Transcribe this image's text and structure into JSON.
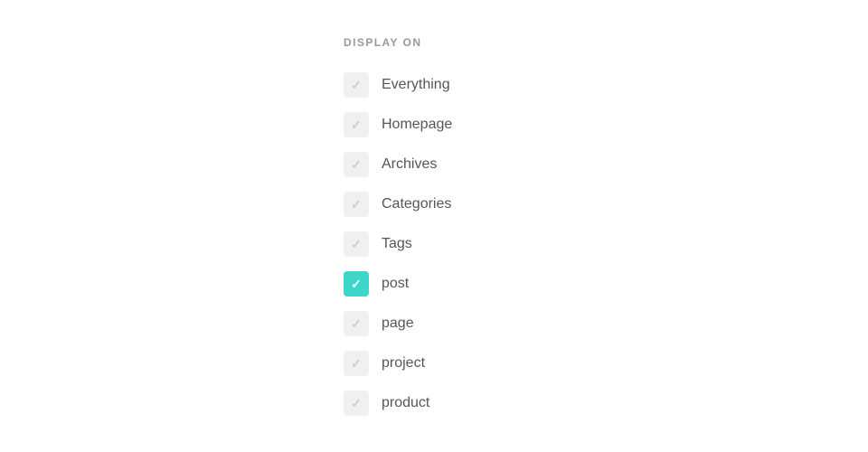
{
  "section": {
    "title": "DISPLAY ON"
  },
  "items": [
    {
      "id": "everything",
      "label": "Everything",
      "checked": false,
      "active": false
    },
    {
      "id": "homepage",
      "label": "Homepage",
      "checked": false,
      "active": false
    },
    {
      "id": "archives",
      "label": "Archives",
      "checked": false,
      "active": false
    },
    {
      "id": "categories",
      "label": "Categories",
      "checked": false,
      "active": false
    },
    {
      "id": "tags",
      "label": "Tags",
      "checked": false,
      "active": false
    },
    {
      "id": "post",
      "label": "post",
      "checked": true,
      "active": true
    },
    {
      "id": "page",
      "label": "page",
      "checked": false,
      "active": false
    },
    {
      "id": "project",
      "label": "project",
      "checked": false,
      "active": false
    },
    {
      "id": "product",
      "label": "product",
      "checked": false,
      "active": false
    }
  ],
  "colors": {
    "checked_active": "#3dd6c8",
    "checked_inactive": "#f0f0f0",
    "checkmark_inactive": "#cccccc",
    "checkmark_active": "#ffffff"
  }
}
